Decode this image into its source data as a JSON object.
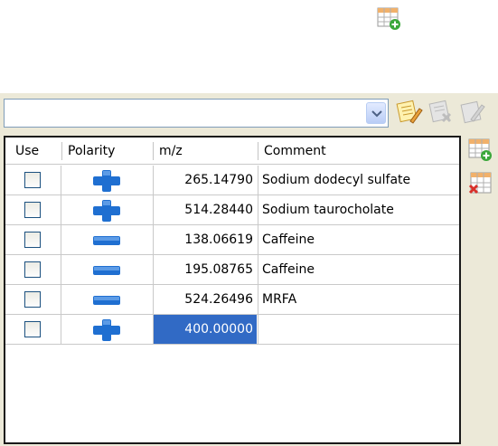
{
  "icons": {
    "top_add": "add-row-icon",
    "edit": "edit-list-icon",
    "remove": "remove-list-icon",
    "rename": "rename-list-icon",
    "add_row": "add-row-icon",
    "delete_row": "delete-row-icon",
    "dropdown": "chevron-down-icon"
  },
  "combo": {
    "value": ""
  },
  "table": {
    "headers": {
      "use": "Use",
      "polarity": "Polarity",
      "mz": "m/z",
      "comment": "Comment"
    },
    "rows": [
      {
        "use": false,
        "polarity": "positive",
        "mz": "265.14790",
        "comment": "Sodium dodecyl sulfate"
      },
      {
        "use": false,
        "polarity": "positive",
        "mz": "514.28440",
        "comment": "Sodium taurocholate"
      },
      {
        "use": false,
        "polarity": "negative",
        "mz": "138.06619",
        "comment": "Caffeine"
      },
      {
        "use": false,
        "polarity": "negative",
        "mz": "195.08765",
        "comment": "Caffeine"
      },
      {
        "use": false,
        "polarity": "negative",
        "mz": "524.26496",
        "comment": "MRFA"
      },
      {
        "use": false,
        "polarity": "positive",
        "mz": "400.00000",
        "comment": "",
        "selected": true
      }
    ]
  },
  "colors": {
    "panel": "#ece9d8",
    "selection": "#316ac5",
    "polarity_blue": "#1f6fd1"
  }
}
